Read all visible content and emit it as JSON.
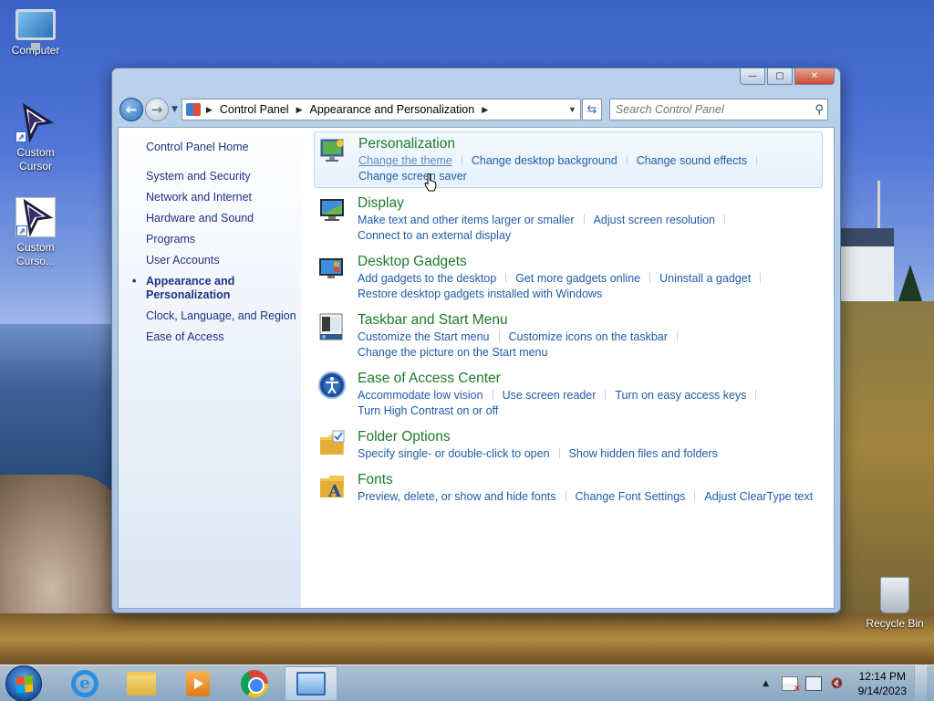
{
  "desktop": {
    "icons": [
      {
        "label": "Computer"
      },
      {
        "label": "Custom Cursor"
      },
      {
        "label": "Custom Curso..."
      },
      {
        "label": "Recycle Bin"
      }
    ]
  },
  "window": {
    "controls": {
      "minimize": "—",
      "maximize": "▢",
      "close": "✕"
    },
    "breadcrumb": [
      "Control Panel",
      "Appearance and Personalization"
    ],
    "search": {
      "placeholder": "Search Control Panel",
      "value": ""
    }
  },
  "sidebar": {
    "home": "Control Panel Home",
    "items": [
      {
        "label": "System and Security"
      },
      {
        "label": "Network and Internet"
      },
      {
        "label": "Hardware and Sound"
      },
      {
        "label": "Programs"
      },
      {
        "label": "User Accounts"
      },
      {
        "label": "Appearance and Personalization",
        "active": true
      },
      {
        "label": "Clock, Language, and Region"
      },
      {
        "label": "Ease of Access"
      }
    ]
  },
  "sections": [
    {
      "title": "Personalization",
      "icon": "personalization-icon",
      "links": [
        "Change the theme",
        "Change desktop background",
        "Change sound effects",
        "Change screen saver"
      ]
    },
    {
      "title": "Display",
      "icon": "display-icon",
      "links": [
        "Make text and other items larger or smaller",
        "Adjust screen resolution",
        "Connect to an external display"
      ]
    },
    {
      "title": "Desktop Gadgets",
      "icon": "gadgets-icon",
      "links": [
        "Add gadgets to the desktop",
        "Get more gadgets online",
        "Uninstall a gadget",
        "Restore desktop gadgets installed with Windows"
      ]
    },
    {
      "title": "Taskbar and Start Menu",
      "icon": "taskbar-icon",
      "links": [
        "Customize the Start menu",
        "Customize icons on the taskbar",
        "Change the picture on the Start menu"
      ]
    },
    {
      "title": "Ease of Access Center",
      "icon": "ease-of-access-icon",
      "links": [
        "Accommodate low vision",
        "Use screen reader",
        "Turn on easy access keys",
        "Turn High Contrast on or off"
      ]
    },
    {
      "title": "Folder Options",
      "icon": "folder-options-icon",
      "links": [
        "Specify single- or double-click to open",
        "Show hidden files and folders"
      ]
    },
    {
      "title": "Fonts",
      "icon": "fonts-icon",
      "links": [
        "Preview, delete, or show and hide fonts",
        "Change Font Settings",
        "Adjust ClearType text"
      ]
    }
  ],
  "taskbar": {
    "clock": {
      "time": "12:14 PM",
      "date": "9/14/2023"
    }
  }
}
